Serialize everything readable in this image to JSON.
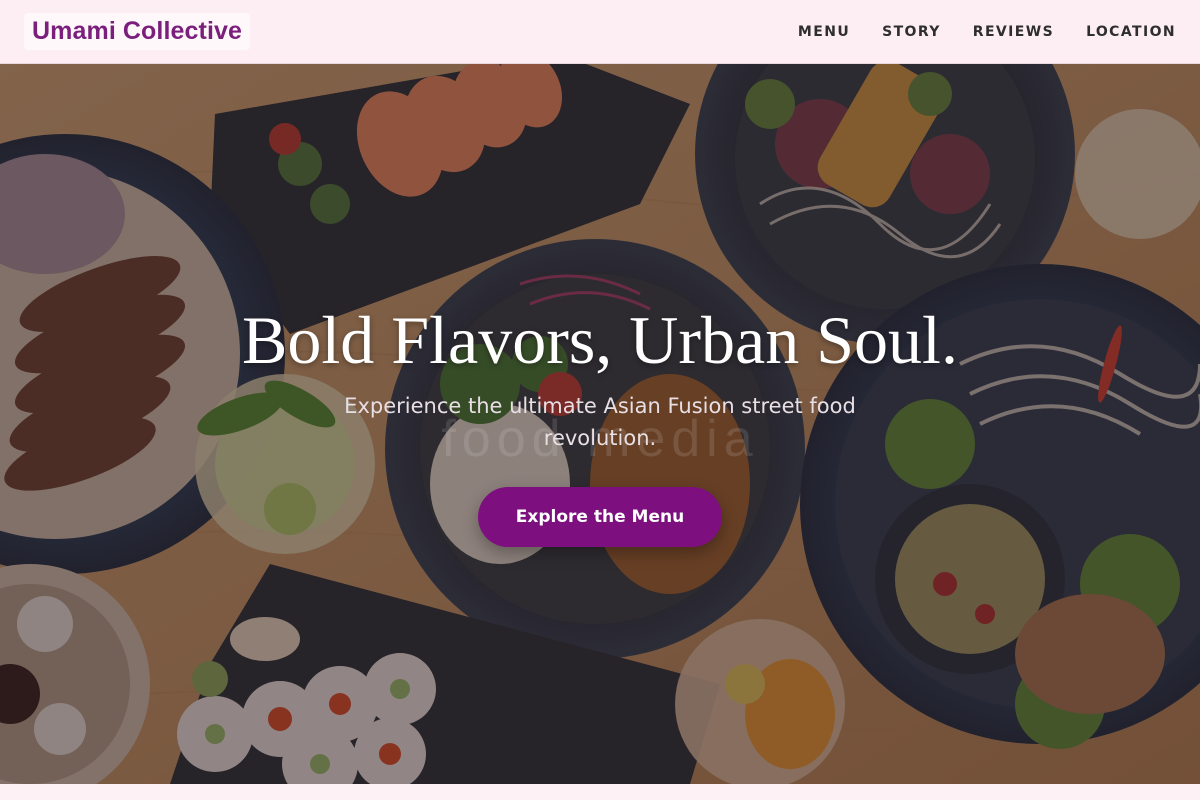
{
  "header": {
    "brand": "Umami Collective",
    "nav": [
      {
        "label": "MENU"
      },
      {
        "label": "STORY"
      },
      {
        "label": "REVIEWS"
      },
      {
        "label": "LOCATION"
      }
    ]
  },
  "hero": {
    "title": "Bold Flavors, Urban Soul.",
    "subtitle": "Experience the ultimate Asian Fusion street food revolution.",
    "cta_label": "Explore the Menu",
    "background_text": "food media"
  },
  "colors": {
    "brand": "#7b1f7d",
    "cta": "#7d0f7f",
    "nav_bg": "#fdeef3"
  }
}
